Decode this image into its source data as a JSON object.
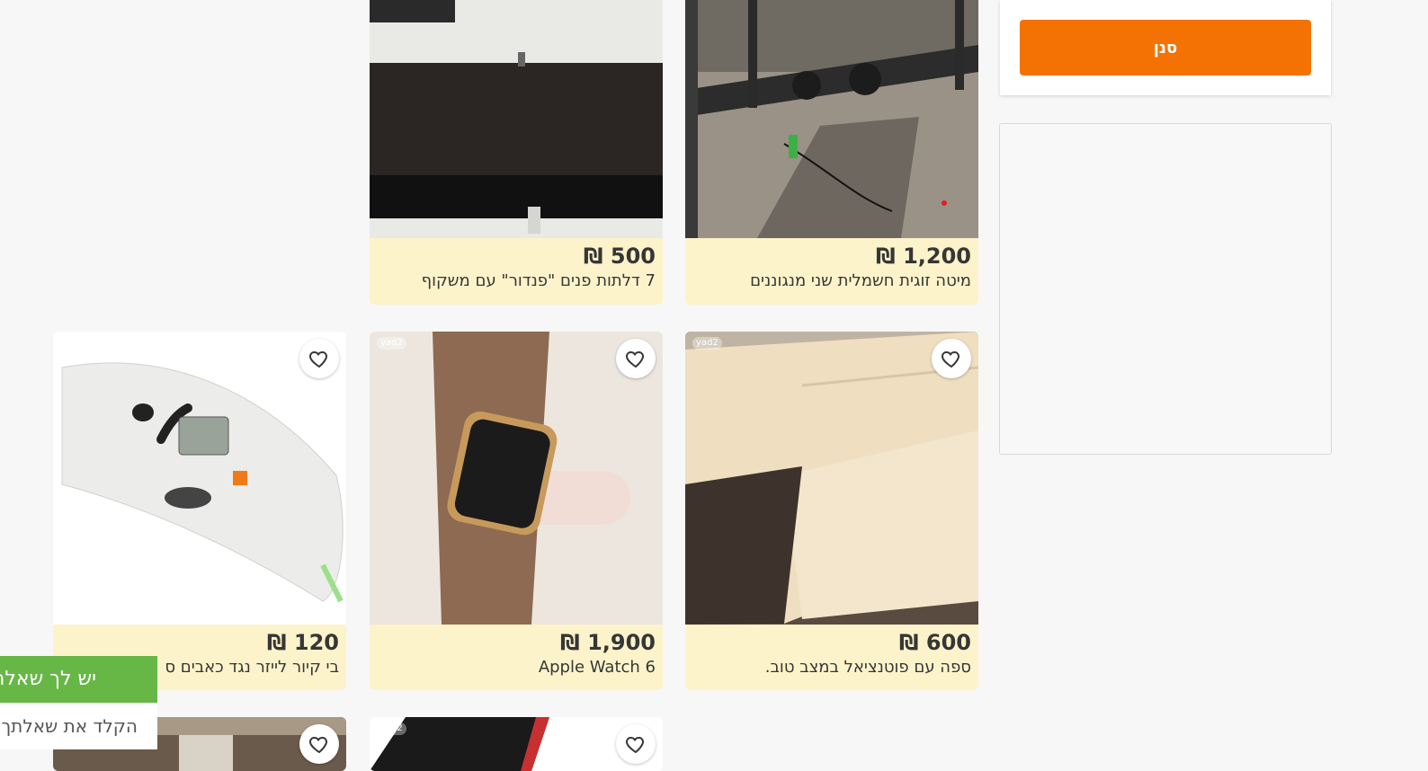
{
  "sidebar": {
    "filter_button_label": "סנן"
  },
  "listings": [
    {
      "price": "1,200 ₪",
      "title": "מיטה זוגית חשמלית שני מנגוננים"
    },
    {
      "price": "500 ₪",
      "title": "7 דלתות פנים \"פנדור\" עם משקוף"
    },
    {
      "price": "600 ₪",
      "title": "ספה עם פוטנציאל במצב טוב.",
      "watermark": "yad2"
    },
    {
      "price": "1,900 ₪",
      "title": "Apple Watch 6",
      "watermark": "yad2"
    },
    {
      "price": "120 ₪",
      "title": "בי קיור לייזר נגד כאבים ס",
      "watermark": "yad2"
    },
    {
      "watermark": "yad2"
    }
  ],
  "help_widget": {
    "title": "יש לך שאלה",
    "subtitle": "הקלד את שאלתך"
  },
  "icons": {
    "favorite": "heart-outline-icon"
  },
  "colors": {
    "accent_orange": "#f37203",
    "help_green": "#67b746",
    "card_info_bg": "#fdf3cb"
  }
}
